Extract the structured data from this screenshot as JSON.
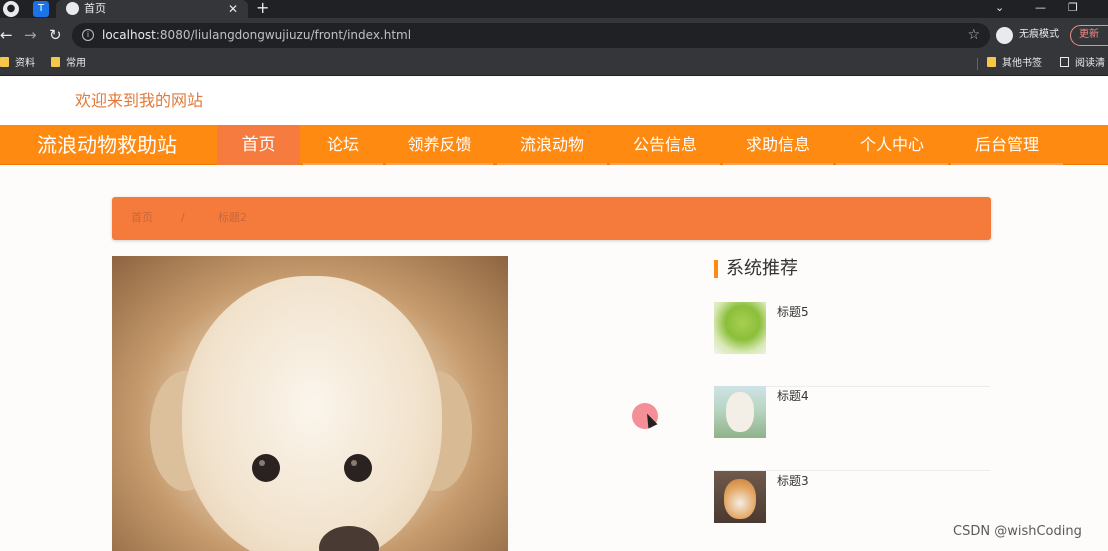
{
  "browser": {
    "tab_title": "首页",
    "new_tab": "+",
    "url_host": "localhost",
    "url_path": ":8080/liulangdongwujiuzu/front/index.html",
    "incognito_label": "无痕模式",
    "update_label": "更新",
    "bookmarks": [
      "资料",
      "常用"
    ],
    "bookmarks_right": [
      "其他书签",
      "阅读清"
    ]
  },
  "site": {
    "welcome": "欢迎来到我的网站",
    "brand": "流浪动物救助站",
    "brand_color": "#ff8a12",
    "nav": [
      "首页",
      "论坛",
      "领养反馈",
      "流浪动物",
      "公告信息",
      "求助信息",
      "个人中心",
      "后台管理"
    ],
    "active_nav": "首页"
  },
  "breadcrumb": {
    "home": "首页",
    "separator": "/",
    "current": "标题2"
  },
  "sidebar": {
    "title": "系统推荐",
    "items": [
      {
        "label": "标题5"
      },
      {
        "label": "标题4"
      },
      {
        "label": "标题3"
      }
    ]
  },
  "watermark": "CSDN @wishCoding"
}
